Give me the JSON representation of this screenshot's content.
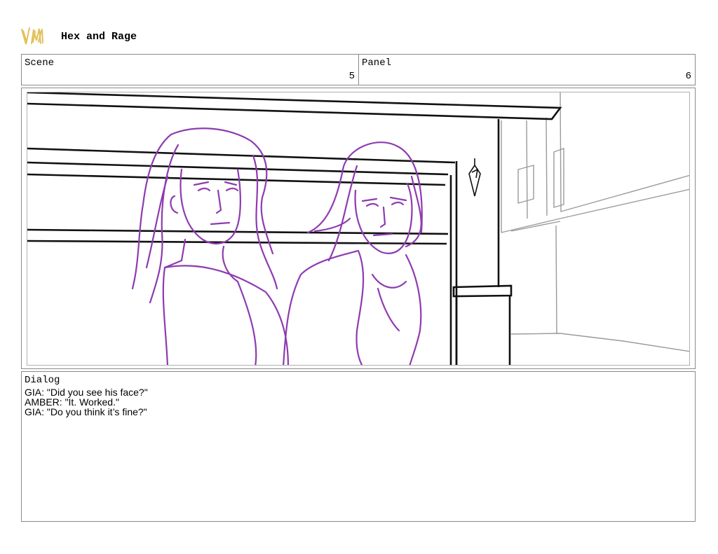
{
  "header": {
    "logo_icon": "gold-sketch-logo",
    "project_title": "Hex and Rage"
  },
  "scene": {
    "label": "Scene",
    "value": "5"
  },
  "panel": {
    "label": "Panel",
    "value": "6"
  },
  "illustration": {
    "subject": "two-women-storefront-sketch",
    "figure_color": "#8e3bb0",
    "line_color": "#111111",
    "background_line_color": "#9a9a9a"
  },
  "dialog": {
    "label": "Dialog",
    "lines": [
      "GIA: \"Did you see his face?\"",
      "AMBER: \"It. Worked.\"",
      "GIA: \"Do you think it’s fine?\""
    ]
  },
  "colors": {
    "border": "#8a8a8a",
    "logo_gold": "#e2c15a"
  }
}
